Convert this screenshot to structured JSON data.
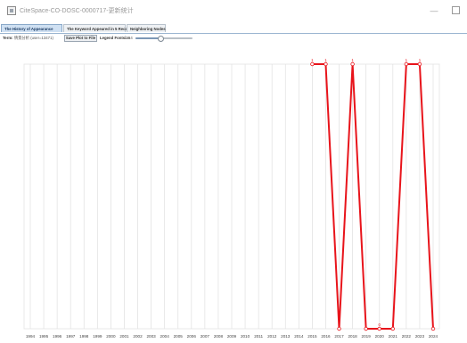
{
  "window": {
    "title": "CiteSpace-CO-DOSC-0000717-更新统计",
    "min_glyph": "—"
  },
  "tabs": [
    {
      "label": "The History of Appearance",
      "active": true
    },
    {
      "label": "The Keyword Appeared in 5 Records",
      "active": false
    },
    {
      "label": "Neighboring Nodes",
      "active": false
    }
  ],
  "toolbar": {
    "term_label": "Term:",
    "term_value": "情景分析 (user=13471)",
    "save_button": "Save Plot to File",
    "legend_label": "Legend Fontsize",
    "legend_value": "14",
    "legend_fraction": 0.43
  },
  "colors": {
    "line": "#e8141b",
    "gridline": "#e3e3e3",
    "axis_text": "#444444"
  },
  "chart_data": {
    "type": "line",
    "x": [
      "1994",
      "1995",
      "1996",
      "1997",
      "1998",
      "1999",
      "2000",
      "2001",
      "2002",
      "2003",
      "2004",
      "2005",
      "2006",
      "2007",
      "2008",
      "2009",
      "2010",
      "2011",
      "2012",
      "2013",
      "2014",
      "2015",
      "2016",
      "2017",
      "2018",
      "2019",
      "2020",
      "2021",
      "2022",
      "2023",
      "2024"
    ],
    "series": [
      {
        "x": [
          "2015",
          "2016",
          "2017",
          "2018",
          "2019",
          "2020",
          "2021",
          "2022",
          "2023",
          "2024"
        ],
        "values": [
          1,
          1,
          0,
          1,
          0,
          0,
          0,
          1,
          1,
          0
        ],
        "labels": [
          "1",
          "1",
          "",
          "1",
          "",
          "0",
          "",
          "1",
          "1",
          ""
        ]
      }
    ],
    "ylim": [
      0,
      1
    ],
    "grid": true,
    "legend": "none"
  }
}
